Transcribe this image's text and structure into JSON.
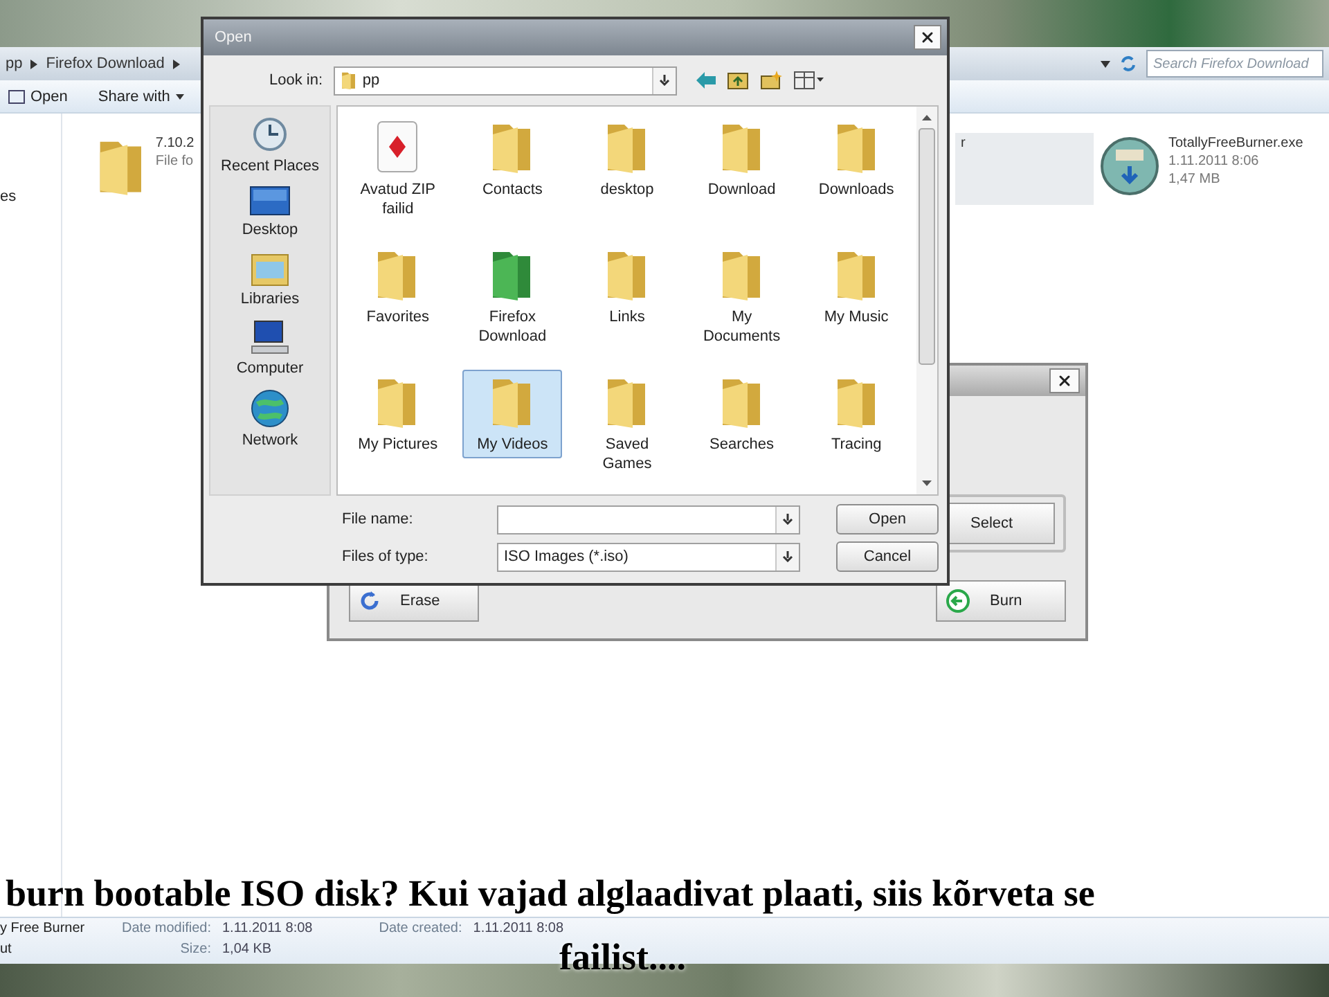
{
  "explorer": {
    "breadcrumb": [
      "pp",
      "Firefox Download"
    ],
    "search": {
      "placeholder": "Search Firefox Download"
    },
    "toolbar": [
      {
        "label": "Open",
        "kind": "open"
      },
      {
        "label": "Share with",
        "kind": "menu"
      }
    ],
    "nav_items": [
      "es"
    ],
    "files": [
      {
        "name": "7.10.2",
        "detail": "File fo",
        "kind": "folder"
      },
      {
        "name": "r",
        "kind": "hidden"
      },
      {
        "name": "TotallyFreeBurner.exe",
        "detail": "1.11.2011 8:06",
        "size": "1,47 MB",
        "kind": "installer"
      }
    ],
    "details": {
      "name": "y Free Burner",
      "type": "ut",
      "fields": [
        {
          "label": "Date modified:",
          "value": "1.11.2011 8:08"
        },
        {
          "label": "Size:",
          "value": "1,04 KB"
        },
        {
          "label": "Date created:",
          "value": "1.11.2011 8:08"
        }
      ]
    }
  },
  "burner": {
    "buttons": [
      {
        "label": "Select",
        "kind": "select"
      },
      {
        "label": "Erase",
        "kind": "erase"
      },
      {
        "label": "Burn",
        "kind": "burn"
      }
    ]
  },
  "open_dialog": {
    "title": "Open",
    "look_in_label": "Look in:",
    "look_in": "pp",
    "places": [
      {
        "label": "Recent Places",
        "kind": "recent"
      },
      {
        "label": "Desktop",
        "kind": "desktop"
      },
      {
        "label": "Libraries",
        "kind": "libraries"
      },
      {
        "label": "Computer",
        "kind": "computer"
      },
      {
        "label": "Network",
        "kind": "network"
      }
    ],
    "items": [
      {
        "label": "Avatud ZIP failid",
        "kind": "card",
        "selected": false
      },
      {
        "label": "Contacts",
        "kind": "folder",
        "selected": false
      },
      {
        "label": "desktop",
        "kind": "folder",
        "selected": false
      },
      {
        "label": "Download",
        "kind": "folder",
        "selected": false
      },
      {
        "label": "Downloads",
        "kind": "folder",
        "selected": false
      },
      {
        "label": "Favorites",
        "kind": "folder",
        "selected": false
      },
      {
        "label": "Firefox Download",
        "kind": "green-folder",
        "selected": false
      },
      {
        "label": "Links",
        "kind": "folder",
        "selected": false
      },
      {
        "label": "My Documents",
        "kind": "folder",
        "selected": false
      },
      {
        "label": "My Music",
        "kind": "folder",
        "selected": false
      },
      {
        "label": "My Pictures",
        "kind": "folder",
        "selected": false
      },
      {
        "label": "My Videos",
        "kind": "folder",
        "selected": true
      },
      {
        "label": "Saved Games",
        "kind": "folder",
        "selected": false
      },
      {
        "label": "Searches",
        "kind": "folder",
        "selected": false
      },
      {
        "label": "Tracing",
        "kind": "folder",
        "selected": false
      }
    ],
    "file_name_label": "File name:",
    "files_of_type_label": "Files of type:",
    "files_of_type": "ISO Images (*.iso)",
    "buttons": [
      "Open",
      "Cancel"
    ]
  },
  "caption": [
    "burn bootable ISO disk? Kui vajad alglaadivat plaati, siis kõrveta se",
    "failist...."
  ]
}
